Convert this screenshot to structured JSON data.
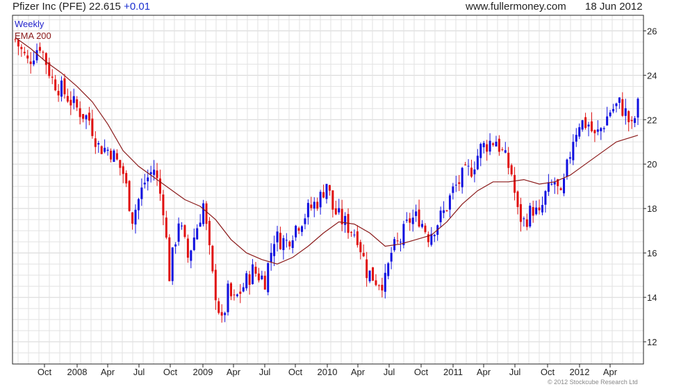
{
  "header": {
    "title": "Pfizer Inc (PFE) 22.615",
    "change": "+0.01",
    "site": "www.fullermoney.com",
    "date": "18 Jun 2012"
  },
  "legend": {
    "interval": "Weekly",
    "ema": "EMA 200"
  },
  "copyright": "© 2012 Stockcube Research Ltd",
  "colors": {
    "up": "#1010e0",
    "down": "#e01010",
    "ema": "#8b1a1a",
    "grid": "#e2e2e2",
    "axis": "#222222"
  },
  "chart_data": {
    "type": "candlestick",
    "x_tick_labels": [
      "Oct",
      "2008",
      "Apr",
      "Jul",
      "Oct",
      "2009",
      "Apr",
      "Jul",
      "Oct",
      "2010",
      "Apr",
      "Jul",
      "Oct",
      "2011",
      "Apr",
      "Jul",
      "Oct",
      "2012",
      "Apr"
    ],
    "y_ticks": [
      12,
      14,
      16,
      18,
      20,
      22,
      24,
      26
    ],
    "ylim": [
      11.0,
      26.7
    ],
    "grid": true,
    "price_series": [
      {
        "week": 0,
        "close": 25.6
      },
      {
        "week": 8,
        "close": 24.6
      },
      {
        "week": 16,
        "close": 25.4
      },
      {
        "week": 24,
        "close": 23.8
      },
      {
        "week": 32,
        "close": 23.2
      },
      {
        "week": 40,
        "close": 22.5
      },
      {
        "week": 48,
        "close": 22.0
      },
      {
        "week": 54,
        "close": 20.8
      },
      {
        "week": 62,
        "close": 20.6
      },
      {
        "week": 70,
        "close": 19.6
      },
      {
        "week": 76,
        "close": 17.6
      },
      {
        "week": 84,
        "close": 19.2
      },
      {
        "week": 90,
        "close": 19.8
      },
      {
        "week": 96,
        "close": 18.1
      },
      {
        "week": 100,
        "close": 15.0
      },
      {
        "week": 106,
        "close": 17.5
      },
      {
        "week": 112,
        "close": 15.8
      },
      {
        "week": 118,
        "close": 17.2
      },
      {
        "week": 122,
        "close": 18.2
      },
      {
        "week": 128,
        "close": 14.9
      },
      {
        "week": 134,
        "close": 12.8
      },
      {
        "week": 138,
        "close": 14.2
      },
      {
        "week": 142,
        "close": 13.8
      },
      {
        "week": 148,
        "close": 14.5
      },
      {
        "week": 154,
        "close": 15.2
      },
      {
        "week": 162,
        "close": 14.8
      },
      {
        "week": 168,
        "close": 16.7
      },
      {
        "week": 176,
        "close": 16.5
      },
      {
        "week": 182,
        "close": 17.2
      },
      {
        "week": 190,
        "close": 17.9
      },
      {
        "week": 198,
        "close": 18.5
      },
      {
        "week": 202,
        "close": 19.2
      },
      {
        "week": 206,
        "close": 18.0
      },
      {
        "week": 210,
        "close": 17.6
      },
      {
        "week": 216,
        "close": 17.2
      },
      {
        "week": 222,
        "close": 16.8
      },
      {
        "week": 228,
        "close": 15.2
      },
      {
        "week": 234,
        "close": 14.8
      },
      {
        "week": 240,
        "close": 14.7
      },
      {
        "week": 244,
        "close": 16.0
      },
      {
        "week": 250,
        "close": 16.6
      },
      {
        "week": 256,
        "close": 17.5
      },
      {
        "week": 262,
        "close": 17.6
      },
      {
        "week": 268,
        "close": 16.8
      },
      {
        "week": 272,
        "close": 17.2
      },
      {
        "week": 278,
        "close": 17.8
      },
      {
        "week": 284,
        "close": 18.8
      },
      {
        "week": 290,
        "close": 19.4
      },
      {
        "week": 296,
        "close": 19.8
      },
      {
        "week": 302,
        "close": 20.7
      },
      {
        "week": 308,
        "close": 21.0
      },
      {
        "week": 312,
        "close": 21.1
      },
      {
        "week": 318,
        "close": 20.2
      },
      {
        "week": 322,
        "close": 19.6
      },
      {
        "week": 326,
        "close": 17.8
      },
      {
        "week": 330,
        "close": 17.4
      },
      {
        "week": 336,
        "close": 18.0
      },
      {
        "week": 340,
        "close": 17.6
      },
      {
        "week": 344,
        "close": 18.6
      },
      {
        "week": 350,
        "close": 19.2
      },
      {
        "week": 354,
        "close": 18.4
      },
      {
        "week": 358,
        "close": 19.8
      },
      {
        "week": 362,
        "close": 21.2
      },
      {
        "week": 366,
        "close": 21.9
      },
      {
        "week": 372,
        "close": 21.8
      },
      {
        "week": 376,
        "close": 21.2
      },
      {
        "week": 380,
        "close": 21.6
      },
      {
        "week": 386,
        "close": 22.4
      },
      {
        "week": 392,
        "close": 22.7
      },
      {
        "week": 396,
        "close": 22.3
      },
      {
        "week": 400,
        "close": 21.6
      },
      {
        "week": 404,
        "close": 22.6
      }
    ],
    "ema_200": [
      {
        "week": 0,
        "value": 25.7
      },
      {
        "week": 10,
        "value": 25.2
      },
      {
        "week": 20,
        "value": 24.6
      },
      {
        "week": 30,
        "value": 24.1
      },
      {
        "week": 40,
        "value": 23.5
      },
      {
        "week": 50,
        "value": 22.8
      },
      {
        "week": 60,
        "value": 21.8
      },
      {
        "week": 70,
        "value": 20.6
      },
      {
        "week": 80,
        "value": 19.9
      },
      {
        "week": 90,
        "value": 19.4
      },
      {
        "week": 100,
        "value": 18.9
      },
      {
        "week": 110,
        "value": 18.4
      },
      {
        "week": 120,
        "value": 18.1
      },
      {
        "week": 130,
        "value": 17.5
      },
      {
        "week": 140,
        "value": 16.6
      },
      {
        "week": 150,
        "value": 16.0
      },
      {
        "week": 160,
        "value": 15.7
      },
      {
        "week": 170,
        "value": 15.5
      },
      {
        "week": 180,
        "value": 15.8
      },
      {
        "week": 190,
        "value": 16.3
      },
      {
        "week": 200,
        "value": 16.9
      },
      {
        "week": 210,
        "value": 17.4
      },
      {
        "week": 220,
        "value": 17.3
      },
      {
        "week": 230,
        "value": 16.9
      },
      {
        "week": 240,
        "value": 16.3
      },
      {
        "week": 250,
        "value": 16.4
      },
      {
        "week": 260,
        "value": 16.6
      },
      {
        "week": 270,
        "value": 16.8
      },
      {
        "week": 280,
        "value": 17.4
      },
      {
        "week": 290,
        "value": 18.2
      },
      {
        "week": 300,
        "value": 18.8
      },
      {
        "week": 310,
        "value": 19.2
      },
      {
        "week": 320,
        "value": 19.2
      },
      {
        "week": 330,
        "value": 19.3
      },
      {
        "week": 340,
        "value": 19.1
      },
      {
        "week": 350,
        "value": 19.2
      },
      {
        "week": 360,
        "value": 19.5
      },
      {
        "week": 370,
        "value": 20.0
      },
      {
        "week": 380,
        "value": 20.5
      },
      {
        "week": 390,
        "value": 21.0
      },
      {
        "week": 404,
        "value": 21.3
      }
    ]
  }
}
